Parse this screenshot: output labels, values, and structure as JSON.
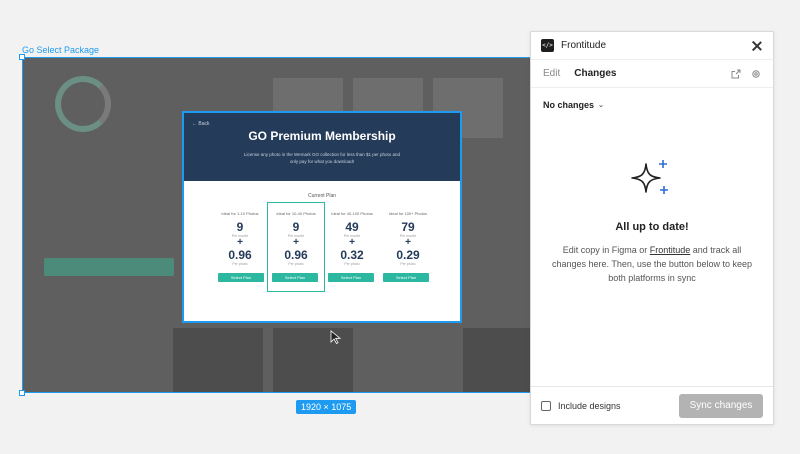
{
  "canvas": {
    "frame_label": "Go Select Package",
    "frame_size": "1920 × 1075"
  },
  "modal": {
    "back_label": "Back",
    "title": "GO Premium Membership",
    "subtitle": "License any photo in the Wemark GO collection for less than $1 per photo and only pay for what you download!",
    "current_plan_label": "Current Plan",
    "plans": [
      {
        "name": "Ideal for 1-10 Photos",
        "price": "9",
        "note": "Per month",
        "price2": "0.96",
        "note2": "Per photo",
        "button": "Select Plan"
      },
      {
        "name": "Ideal for 10-40 Photos",
        "price": "9",
        "note": "Per month",
        "price2": "0.96",
        "note2": "Per photo",
        "button": "Select Plan"
      },
      {
        "name": "Ideal for 40-100 Photos",
        "price": "49",
        "note": "Per month",
        "price2": "0.32",
        "note2": "Per photo",
        "button": "Select Plan"
      },
      {
        "name": "Ideal for 100+ Photos",
        "price": "79",
        "note": "Per month",
        "price2": "0.29",
        "note2": "Per photo",
        "button": "Select Plan"
      }
    ]
  },
  "panel": {
    "title": "Frontitude",
    "logo_glyph": "</>",
    "tabs": [
      "Edit",
      "Changes"
    ],
    "active_tab": "Changes",
    "dropdown_label": "No changes",
    "empty_title": "All up to date!",
    "empty_body_1": "Edit copy in Figma or ",
    "empty_body_link": "Frontitude",
    "empty_body_2": " and track all changes here. Then, use the button below to keep both platforms in sync",
    "include_designs_label": "Include designs",
    "sync_button": "Sync changes"
  },
  "colors": {
    "selection_blue": "#1e9bf0",
    "modal_header": "#253b5a",
    "plan_button": "#2cb8a0",
    "sync_disabled": "#b3b3b3"
  }
}
